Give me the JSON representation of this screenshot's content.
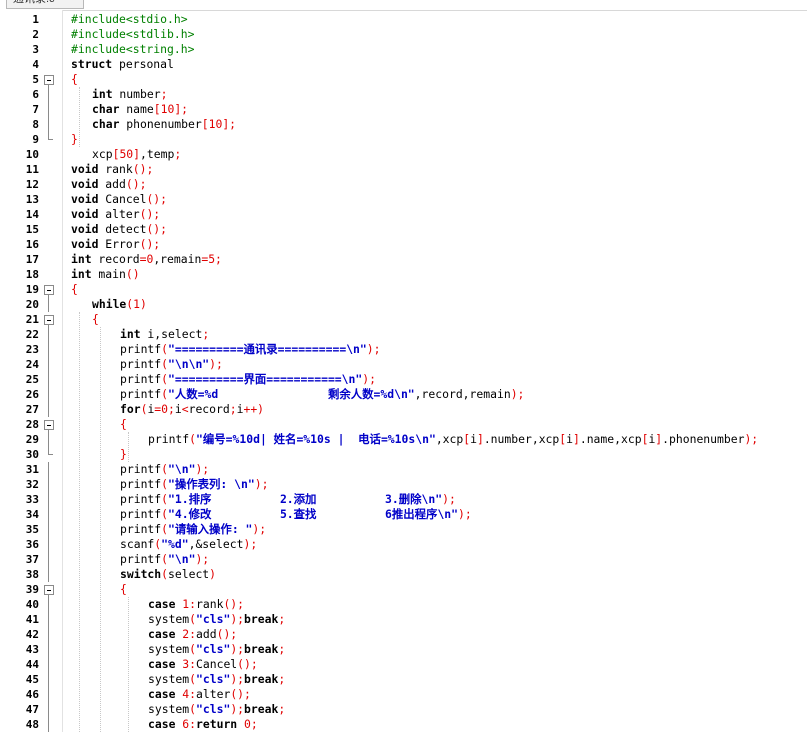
{
  "editor": {
    "tab_label": "通讯录.c",
    "colors": {
      "preprocessor": "#008000",
      "keyword": "#000000",
      "string": "#0000c8",
      "number": "#e00000",
      "bracket": "#e00000"
    },
    "lines": [
      {
        "n": "1",
        "indent": 0,
        "tokens": [
          [
            "pre",
            "#include<stdio.h>"
          ]
        ]
      },
      {
        "n": "2",
        "indent": 0,
        "tokens": [
          [
            "pre",
            "#include<stdlib.h>"
          ]
        ]
      },
      {
        "n": "3",
        "indent": 0,
        "tokens": [
          [
            "pre",
            "#include<string.h>"
          ]
        ]
      },
      {
        "n": "4",
        "indent": 0,
        "tokens": [
          [
            "kw",
            "struct"
          ],
          [
            "id",
            " personal"
          ]
        ]
      },
      {
        "n": "5",
        "indent": 0,
        "fold": "open",
        "tokens": [
          [
            "br",
            "{"
          ]
        ]
      },
      {
        "n": "6",
        "indent": 1,
        "tokens": [
          [
            "kw",
            "int"
          ],
          [
            "id",
            " number"
          ],
          [
            "br",
            ";"
          ]
        ]
      },
      {
        "n": "7",
        "indent": 1,
        "tokens": [
          [
            "kw",
            "char"
          ],
          [
            "id",
            " name"
          ],
          [
            "br",
            "["
          ],
          [
            "num",
            "10"
          ],
          [
            "br",
            "];"
          ]
        ]
      },
      {
        "n": "8",
        "indent": 1,
        "tokens": [
          [
            "kw",
            "char"
          ],
          [
            "id",
            " phonenumber"
          ],
          [
            "br",
            "["
          ],
          [
            "num",
            "10"
          ],
          [
            "br",
            "];"
          ]
        ]
      },
      {
        "n": "9",
        "indent": 0,
        "fold": "end",
        "tokens": [
          [
            "br",
            "}"
          ]
        ]
      },
      {
        "n": "10",
        "indent": 1,
        "tokens": [
          [
            "id",
            "xcp"
          ],
          [
            "br",
            "["
          ],
          [
            "num",
            "50"
          ],
          [
            "br",
            "]"
          ],
          [
            "id",
            ",temp"
          ],
          [
            "br",
            ";"
          ]
        ]
      },
      {
        "n": "11",
        "indent": 0,
        "tokens": [
          [
            "kw",
            "void"
          ],
          [
            "id",
            " rank"
          ],
          [
            "br",
            "();"
          ]
        ]
      },
      {
        "n": "12",
        "indent": 0,
        "tokens": [
          [
            "kw",
            "void"
          ],
          [
            "id",
            " add"
          ],
          [
            "br",
            "();"
          ]
        ]
      },
      {
        "n": "13",
        "indent": 0,
        "tokens": [
          [
            "kw",
            "void"
          ],
          [
            "id",
            " Cancel"
          ],
          [
            "br",
            "();"
          ]
        ]
      },
      {
        "n": "14",
        "indent": 0,
        "tokens": [
          [
            "kw",
            "void"
          ],
          [
            "id",
            " alter"
          ],
          [
            "br",
            "();"
          ]
        ]
      },
      {
        "n": "15",
        "indent": 0,
        "tokens": [
          [
            "kw",
            "void"
          ],
          [
            "id",
            " detect"
          ],
          [
            "br",
            "();"
          ]
        ]
      },
      {
        "n": "16",
        "indent": 0,
        "tokens": [
          [
            "kw",
            "void"
          ],
          [
            "id",
            " Error"
          ],
          [
            "br",
            "();"
          ]
        ]
      },
      {
        "n": "17",
        "indent": 0,
        "tokens": [
          [
            "kw",
            "int"
          ],
          [
            "id",
            " record"
          ],
          [
            "br",
            "="
          ],
          [
            "num",
            "0"
          ],
          [
            "id",
            ",remain"
          ],
          [
            "br",
            "="
          ],
          [
            "num",
            "5"
          ],
          [
            "br",
            ";"
          ]
        ]
      },
      {
        "n": "18",
        "indent": 0,
        "tokens": [
          [
            "kw",
            "int"
          ],
          [
            "id",
            " main"
          ],
          [
            "br",
            "()"
          ]
        ]
      },
      {
        "n": "19",
        "indent": 0,
        "fold": "open",
        "tokens": [
          [
            "br",
            "{"
          ]
        ]
      },
      {
        "n": "20",
        "indent": 1,
        "tokens": [
          [
            "kw",
            "while"
          ],
          [
            "br",
            "("
          ],
          [
            "num",
            "1"
          ],
          [
            "br",
            ")"
          ]
        ]
      },
      {
        "n": "21",
        "indent": 1,
        "fold": "open",
        "tokens": [
          [
            "br",
            "{"
          ]
        ]
      },
      {
        "n": "22",
        "indent": 2,
        "tokens": [
          [
            "kw",
            "int"
          ],
          [
            "id",
            " i,select"
          ],
          [
            "br",
            ";"
          ]
        ]
      },
      {
        "n": "23",
        "indent": 2,
        "tokens": [
          [
            "id",
            "printf"
          ],
          [
            "br",
            "("
          ],
          [
            "str",
            "\"==========通讯录==========\\n\""
          ],
          [
            "br",
            ");"
          ]
        ]
      },
      {
        "n": "24",
        "indent": 2,
        "tokens": [
          [
            "id",
            "printf"
          ],
          [
            "br",
            "("
          ],
          [
            "str",
            "\"\\n\\n\""
          ],
          [
            "br",
            ");"
          ]
        ]
      },
      {
        "n": "25",
        "indent": 2,
        "tokens": [
          [
            "id",
            "printf"
          ],
          [
            "br",
            "("
          ],
          [
            "str",
            "\"==========界面===========\\n\""
          ],
          [
            "br",
            ");"
          ]
        ]
      },
      {
        "n": "26",
        "indent": 2,
        "tokens": [
          [
            "id",
            "printf"
          ],
          [
            "br",
            "("
          ],
          [
            "str",
            "\"人数=%d                剩余人数=%d\\n\""
          ],
          [
            "id",
            ",record,remain"
          ],
          [
            "br",
            ");"
          ]
        ]
      },
      {
        "n": "27",
        "indent": 2,
        "tokens": [
          [
            "kw",
            "for"
          ],
          [
            "br",
            "("
          ],
          [
            "id",
            "i"
          ],
          [
            "br",
            "="
          ],
          [
            "num",
            "0"
          ],
          [
            "br",
            ";"
          ],
          [
            "id",
            "i"
          ],
          [
            "br",
            "<"
          ],
          [
            "id",
            "record"
          ],
          [
            "br",
            ";"
          ],
          [
            "id",
            "i"
          ],
          [
            "br",
            "++)"
          ]
        ]
      },
      {
        "n": "28",
        "indent": 2,
        "fold": "open",
        "tokens": [
          [
            "br",
            "{"
          ]
        ]
      },
      {
        "n": "29",
        "indent": 3,
        "tokens": [
          [
            "id",
            "printf"
          ],
          [
            "br",
            "("
          ],
          [
            "str",
            "\"编号=%10d| 姓名=%10s |  电话=%10s\\n\""
          ],
          [
            "id",
            ",xcp"
          ],
          [
            "br",
            "["
          ],
          [
            "id",
            "i"
          ],
          [
            "br",
            "]"
          ],
          [
            "id",
            ".number,xcp"
          ],
          [
            "br",
            "["
          ],
          [
            "id",
            "i"
          ],
          [
            "br",
            "]"
          ],
          [
            "id",
            ".name,xcp"
          ],
          [
            "br",
            "["
          ],
          [
            "id",
            "i"
          ],
          [
            "br",
            "]"
          ],
          [
            "id",
            ".phonenumber"
          ],
          [
            "br",
            ");"
          ]
        ]
      },
      {
        "n": "30",
        "indent": 2,
        "fold": "end",
        "tokens": [
          [
            "br",
            "}"
          ]
        ]
      },
      {
        "n": "31",
        "indent": 2,
        "tokens": [
          [
            "id",
            "printf"
          ],
          [
            "br",
            "("
          ],
          [
            "str",
            "\"\\n\""
          ],
          [
            "br",
            ");"
          ]
        ]
      },
      {
        "n": "32",
        "indent": 2,
        "tokens": [
          [
            "id",
            "printf"
          ],
          [
            "br",
            "("
          ],
          [
            "str",
            "\"操作表列: \\n\""
          ],
          [
            "br",
            ");"
          ]
        ]
      },
      {
        "n": "33",
        "indent": 2,
        "tokens": [
          [
            "id",
            "printf"
          ],
          [
            "br",
            "("
          ],
          [
            "str",
            "\"1.排序          2.添加          3.删除\\n\""
          ],
          [
            "br",
            ");"
          ]
        ]
      },
      {
        "n": "34",
        "indent": 2,
        "tokens": [
          [
            "id",
            "printf"
          ],
          [
            "br",
            "("
          ],
          [
            "str",
            "\"4.修改          5.查找          6推出程序\\n\""
          ],
          [
            "br",
            ");"
          ]
        ]
      },
      {
        "n": "35",
        "indent": 2,
        "tokens": [
          [
            "id",
            "printf"
          ],
          [
            "br",
            "("
          ],
          [
            "str",
            "\"请输入操作: \""
          ],
          [
            "br",
            ");"
          ]
        ]
      },
      {
        "n": "36",
        "indent": 2,
        "tokens": [
          [
            "id",
            "scanf"
          ],
          [
            "br",
            "("
          ],
          [
            "str",
            "\"%d\""
          ],
          [
            "id",
            ",&select"
          ],
          [
            "br",
            ");"
          ]
        ]
      },
      {
        "n": "37",
        "indent": 2,
        "tokens": [
          [
            "id",
            "printf"
          ],
          [
            "br",
            "("
          ],
          [
            "str",
            "\"\\n\""
          ],
          [
            "br",
            ");"
          ]
        ]
      },
      {
        "n": "38",
        "indent": 2,
        "tokens": [
          [
            "kw",
            "switch"
          ],
          [
            "br",
            "("
          ],
          [
            "id",
            "select"
          ],
          [
            "br",
            ")"
          ]
        ]
      },
      {
        "n": "39",
        "indent": 2,
        "fold": "open",
        "tokens": [
          [
            "br",
            "{"
          ]
        ]
      },
      {
        "n": "40",
        "indent": 3,
        "tokens": [
          [
            "kw",
            "case"
          ],
          [
            "id",
            " "
          ],
          [
            "num",
            "1"
          ],
          [
            "br",
            ":"
          ],
          [
            "id",
            "rank"
          ],
          [
            "br",
            "();"
          ]
        ]
      },
      {
        "n": "41",
        "indent": 3,
        "tokens": [
          [
            "id",
            "system"
          ],
          [
            "br",
            "("
          ],
          [
            "str",
            "\"cls\""
          ],
          [
            "br",
            ");"
          ],
          [
            "kw",
            "break"
          ],
          [
            "br",
            ";"
          ]
        ]
      },
      {
        "n": "42",
        "indent": 3,
        "tokens": [
          [
            "kw",
            "case"
          ],
          [
            "id",
            " "
          ],
          [
            "num",
            "2"
          ],
          [
            "br",
            ":"
          ],
          [
            "id",
            "add"
          ],
          [
            "br",
            "();"
          ]
        ]
      },
      {
        "n": "43",
        "indent": 3,
        "tokens": [
          [
            "id",
            "system"
          ],
          [
            "br",
            "("
          ],
          [
            "str",
            "\"cls\""
          ],
          [
            "br",
            ");"
          ],
          [
            "kw",
            "break"
          ],
          [
            "br",
            ";"
          ]
        ]
      },
      {
        "n": "44",
        "indent": 3,
        "tokens": [
          [
            "kw",
            "case"
          ],
          [
            "id",
            " "
          ],
          [
            "num",
            "3"
          ],
          [
            "br",
            ":"
          ],
          [
            "id",
            "Cancel"
          ],
          [
            "br",
            "();"
          ]
        ]
      },
      {
        "n": "45",
        "indent": 3,
        "tokens": [
          [
            "id",
            "system"
          ],
          [
            "br",
            "("
          ],
          [
            "str",
            "\"cls\""
          ],
          [
            "br",
            ");"
          ],
          [
            "kw",
            "break"
          ],
          [
            "br",
            ";"
          ]
        ]
      },
      {
        "n": "46",
        "indent": 3,
        "tokens": [
          [
            "kw",
            "case"
          ],
          [
            "id",
            " "
          ],
          [
            "num",
            "4"
          ],
          [
            "br",
            ":"
          ],
          [
            "id",
            "alter"
          ],
          [
            "br",
            "();"
          ]
        ]
      },
      {
        "n": "47",
        "indent": 3,
        "tokens": [
          [
            "id",
            "system"
          ],
          [
            "br",
            "("
          ],
          [
            "str",
            "\"cls\""
          ],
          [
            "br",
            ");"
          ],
          [
            "kw",
            "break"
          ],
          [
            "br",
            ";"
          ]
        ]
      },
      {
        "n": "48",
        "indent": 3,
        "tokens": [
          [
            "kw",
            "case"
          ],
          [
            "id",
            " "
          ],
          [
            "num",
            "6"
          ],
          [
            "br",
            ":"
          ],
          [
            "kw",
            "return"
          ],
          [
            "id",
            " "
          ],
          [
            "num",
            "0"
          ],
          [
            "br",
            ";"
          ]
        ]
      }
    ]
  }
}
